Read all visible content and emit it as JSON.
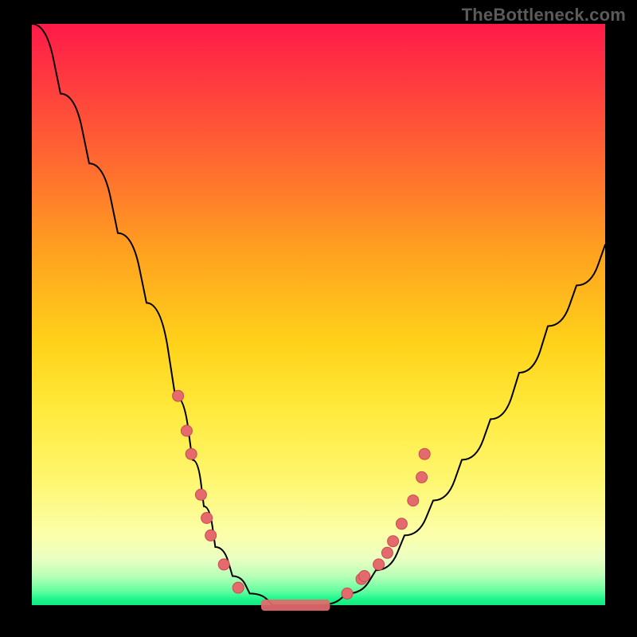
{
  "watermark": "TheBottleneck.com",
  "chart_data": {
    "type": "line",
    "title": "",
    "xlabel": "",
    "ylabel": "",
    "xlim": [
      0,
      100
    ],
    "ylim": [
      0,
      100
    ],
    "grid": false,
    "legend": false,
    "series": [
      {
        "name": "bottleneck-curve",
        "x": [
          0,
          5,
          10,
          15,
          20,
          25,
          28,
          30,
          32,
          35,
          38,
          42,
          45,
          50,
          55,
          60,
          65,
          70,
          75,
          80,
          85,
          90,
          95,
          100
        ],
        "y": [
          100,
          88,
          76,
          64,
          52,
          36,
          25,
          17,
          10,
          5,
          2,
          0,
          0,
          0,
          2,
          6,
          12,
          18,
          25,
          32,
          40,
          48,
          55,
          62
        ]
      }
    ],
    "markers_left": [
      {
        "x": 25.5,
        "y": 36
      },
      {
        "x": 27.0,
        "y": 30
      },
      {
        "x": 27.8,
        "y": 26
      },
      {
        "x": 29.5,
        "y": 19
      },
      {
        "x": 30.5,
        "y": 15
      },
      {
        "x": 31.2,
        "y": 12
      },
      {
        "x": 33.5,
        "y": 7
      },
      {
        "x": 36.0,
        "y": 3
      }
    ],
    "markers_right": [
      {
        "x": 55.0,
        "y": 2
      },
      {
        "x": 57.5,
        "y": 4.5
      },
      {
        "x": 58.0,
        "y": 5
      },
      {
        "x": 60.5,
        "y": 7
      },
      {
        "x": 62.0,
        "y": 9
      },
      {
        "x": 63.0,
        "y": 11
      },
      {
        "x": 64.5,
        "y": 14
      },
      {
        "x": 66.5,
        "y": 18
      },
      {
        "x": 68.0,
        "y": 22
      },
      {
        "x": 68.5,
        "y": 26
      }
    ],
    "bottom_flat": {
      "x_start": 40,
      "x_end": 52,
      "y": 0
    }
  }
}
